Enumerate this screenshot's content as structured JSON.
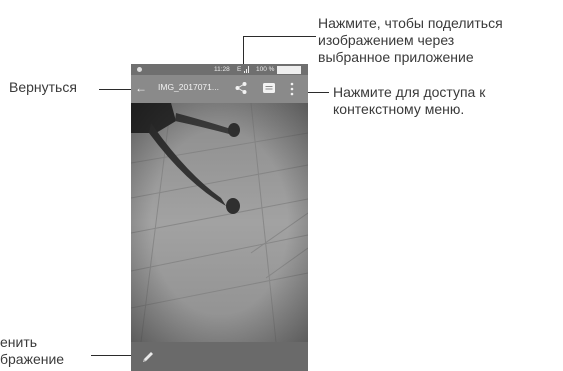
{
  "phone": {
    "status_bar": {
      "time": "11:28",
      "network": "E",
      "battery": "100 %"
    },
    "app_bar": {
      "title": "IMG_2017071..."
    }
  },
  "callouts": {
    "back": "Вернуться",
    "share": "Нажмите, чтобы поделиться изображением через выбранное приложение",
    "share_lines": [
      "Нажмите, чтобы поделиться",
      "изображением через",
      "выбранное приложение"
    ],
    "menu_lines": [
      "Нажмите для доступа к",
      "контекстному меню."
    ],
    "edit_lines": [
      "енить",
      "бражение"
    ]
  },
  "icons": {
    "back": "arrow-left-icon",
    "share": "share-icon",
    "message": "message-icon",
    "menu": "more-vert-icon",
    "edit": "pencil-icon",
    "wifi": "signal-icon",
    "battery": "battery-icon"
  }
}
